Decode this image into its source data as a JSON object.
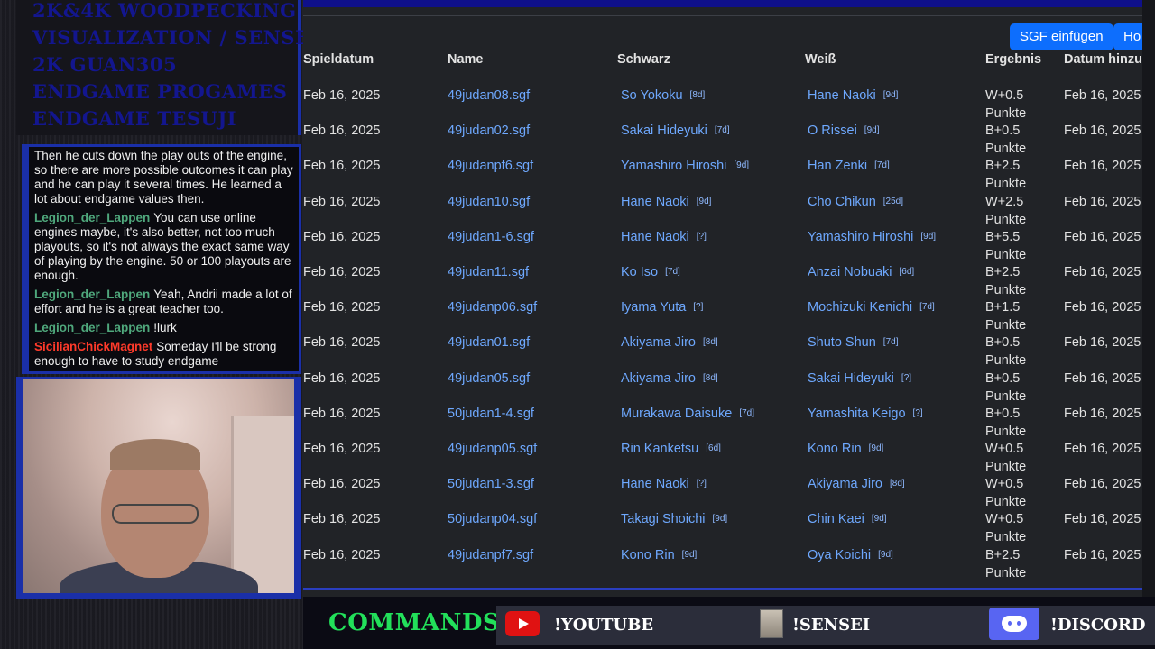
{
  "menu": {
    "items": [
      "2K&4K Woodpecking",
      "Visualization / Sensei",
      "2K Guan305",
      "Endgame Progames",
      "Endgame Tesuji"
    ]
  },
  "chat": {
    "messages": [
      {
        "user": "",
        "user_color": "#ffffff",
        "text": "Then he cuts down the play outs of the engine, so there are more possible outcomes it can play and he can play it several times. He learned a lot about endgame values then."
      },
      {
        "user": "Legion_der_Lappen",
        "user_color": "#4fa87c",
        "text": "You can use online engines maybe, it's also better, not too much playouts, so it's not always the exact same way of playing by the engine. 50 or 100 playouts are enough."
      },
      {
        "user": "Legion_der_Lappen",
        "user_color": "#4fa87c",
        "text": "Yeah, Andrii made a lot of effort and he is a great teacher too."
      },
      {
        "user": "Legion_der_Lappen",
        "user_color": "#4fa87c",
        "text": "!lurk"
      },
      {
        "user": "SicilianChickMagnet",
        "user_color": "#ff3a2a",
        "text": "Someday I'll be strong enough to have to study endgame"
      }
    ]
  },
  "toolbar": {
    "sgf_button": "SGF einfügen",
    "cut_button": "Ho"
  },
  "table": {
    "headers": {
      "date": "Spieldatum",
      "name": "Name",
      "black": "Schwarz",
      "white": "Weiß",
      "result": "Ergebnis",
      "added": "Datum hinzu"
    },
    "rows": [
      {
        "date": "Feb 16, 2025",
        "name": "49judan08.sgf",
        "black": "So Yokoku",
        "black_rank": "[8d]",
        "white": "Hane Naoki",
        "white_rank": "[9d]",
        "result": "W+0.5",
        "result_unit": "Punkte",
        "added": "Feb 16, 2025"
      },
      {
        "date": "Feb 16, 2025",
        "name": "49judan02.sgf",
        "black": "Sakai Hideyuki",
        "black_rank": "[7d]",
        "white": "O Rissei",
        "white_rank": "[9d]",
        "result": "B+0.5",
        "result_unit": "Punkte",
        "added": "Feb 16, 2025"
      },
      {
        "date": "Feb 16, 2025",
        "name": "49judanpf6.sgf",
        "black": "Yamashiro Hiroshi",
        "black_rank": "[9d]",
        "white": "Han Zenki",
        "white_rank": "[7d]",
        "result": "B+2.5",
        "result_unit": "Punkte",
        "added": "Feb 16, 2025"
      },
      {
        "date": "Feb 16, 2025",
        "name": "49judan10.sgf",
        "black": "Hane Naoki",
        "black_rank": "[9d]",
        "white": "Cho Chikun",
        "white_rank": "[25d]",
        "result": "W+2.5",
        "result_unit": "Punkte",
        "added": "Feb 16, 2025"
      },
      {
        "date": "Feb 16, 2025",
        "name": "49judan1-6.sgf",
        "black": "Hane Naoki",
        "black_rank": "[?]",
        "white": "Yamashiro Hiroshi",
        "white_rank": "[9d]",
        "result": "B+5.5",
        "result_unit": "Punkte",
        "added": "Feb 16, 2025"
      },
      {
        "date": "Feb 16, 2025",
        "name": "49judan11.sgf",
        "black": "Ko Iso",
        "black_rank": "[7d]",
        "white": "Anzai Nobuaki",
        "white_rank": "[6d]",
        "result": "B+2.5",
        "result_unit": "Punkte",
        "added": "Feb 16, 2025"
      },
      {
        "date": "Feb 16, 2025",
        "name": "49judanp06.sgf",
        "black": "Iyama Yuta",
        "black_rank": "[?]",
        "white": "Mochizuki Kenichi",
        "white_rank": "[7d]",
        "result": "B+1.5",
        "result_unit": "Punkte",
        "added": "Feb 16, 2025"
      },
      {
        "date": "Feb 16, 2025",
        "name": "49judan01.sgf",
        "black": "Akiyama Jiro",
        "black_rank": "[8d]",
        "white": "Shuto Shun",
        "white_rank": "[7d]",
        "result": "B+0.5",
        "result_unit": "Punkte",
        "added": "Feb 16, 2025"
      },
      {
        "date": "Feb 16, 2025",
        "name": "49judan05.sgf",
        "black": "Akiyama Jiro",
        "black_rank": "[8d]",
        "white": "Sakai Hideyuki",
        "white_rank": "[?]",
        "result": "B+0.5",
        "result_unit": "Punkte",
        "added": "Feb 16, 2025"
      },
      {
        "date": "Feb 16, 2025",
        "name": "50judan1-4.sgf",
        "black": "Murakawa Daisuke",
        "black_rank": "[7d]",
        "white": "Yamashita Keigo",
        "white_rank": "[?]",
        "result": "B+0.5",
        "result_unit": "Punkte",
        "added": "Feb 16, 2025"
      },
      {
        "date": "Feb 16, 2025",
        "name": "49judanp05.sgf",
        "black": "Rin Kanketsu",
        "black_rank": "[6d]",
        "white": "Kono Rin",
        "white_rank": "[9d]",
        "result": "W+0.5",
        "result_unit": "Punkte",
        "added": "Feb 16, 2025"
      },
      {
        "date": "Feb 16, 2025",
        "name": "50judan1-3.sgf",
        "black": "Hane Naoki",
        "black_rank": "[?]",
        "white": "Akiyama Jiro",
        "white_rank": "[8d]",
        "result": "W+0.5",
        "result_unit": "Punkte",
        "added": "Feb 16, 2025"
      },
      {
        "date": "Feb 16, 2025",
        "name": "50judanp04.sgf",
        "black": "Takagi Shoichi",
        "black_rank": "[9d]",
        "white": "Chin Kaei",
        "white_rank": "[9d]",
        "result": "W+0.5",
        "result_unit": "Punkte",
        "added": "Feb 16, 2025"
      },
      {
        "date": "Feb 16, 2025",
        "name": "49judanpf7.sgf",
        "black": "Kono Rin",
        "black_rank": "[9d]",
        "white": "Oya Koichi",
        "white_rank": "[9d]",
        "result": "B+2.5",
        "result_unit": "Punkte",
        "added": "Feb 16, 2025"
      }
    ]
  },
  "commands": {
    "label": "COMMANDS:",
    "youtube": "!YOUTUBE",
    "sensei": "!SENSEI",
    "discord": "!DISCORD"
  }
}
